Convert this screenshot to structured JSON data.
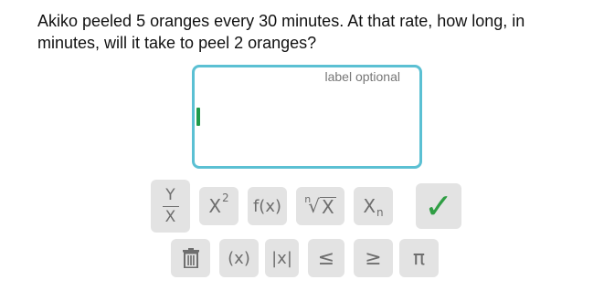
{
  "question": {
    "text": "Akiko peeled 5 oranges every 30 minutes. At that rate, how long, in minutes, will it take to peel 2 oranges?"
  },
  "answer": {
    "label_placeholder": "label optional",
    "value": ""
  },
  "keypad": {
    "row1": {
      "fraction": {
        "numerator": "Y",
        "denominator": "X"
      },
      "power": {
        "base": "X",
        "exponent": "2"
      },
      "function": "f(x)",
      "nth_root": {
        "index": "n",
        "radicand": "X"
      },
      "subscript": {
        "base": "X",
        "subscript": "n"
      }
    },
    "row2": {
      "delete_icon": "trash-icon",
      "parentheses": "(x)",
      "absolute_value": "|x|",
      "less_equal": "≤",
      "greater_equal": "≥",
      "pi": "π"
    },
    "submit_icon": "checkmark-icon"
  },
  "colors": {
    "input_border": "#5bc0d3",
    "key_background": "#e3e3e3",
    "submit_check": "#2f9e44",
    "caret": "#1f9a4a"
  }
}
